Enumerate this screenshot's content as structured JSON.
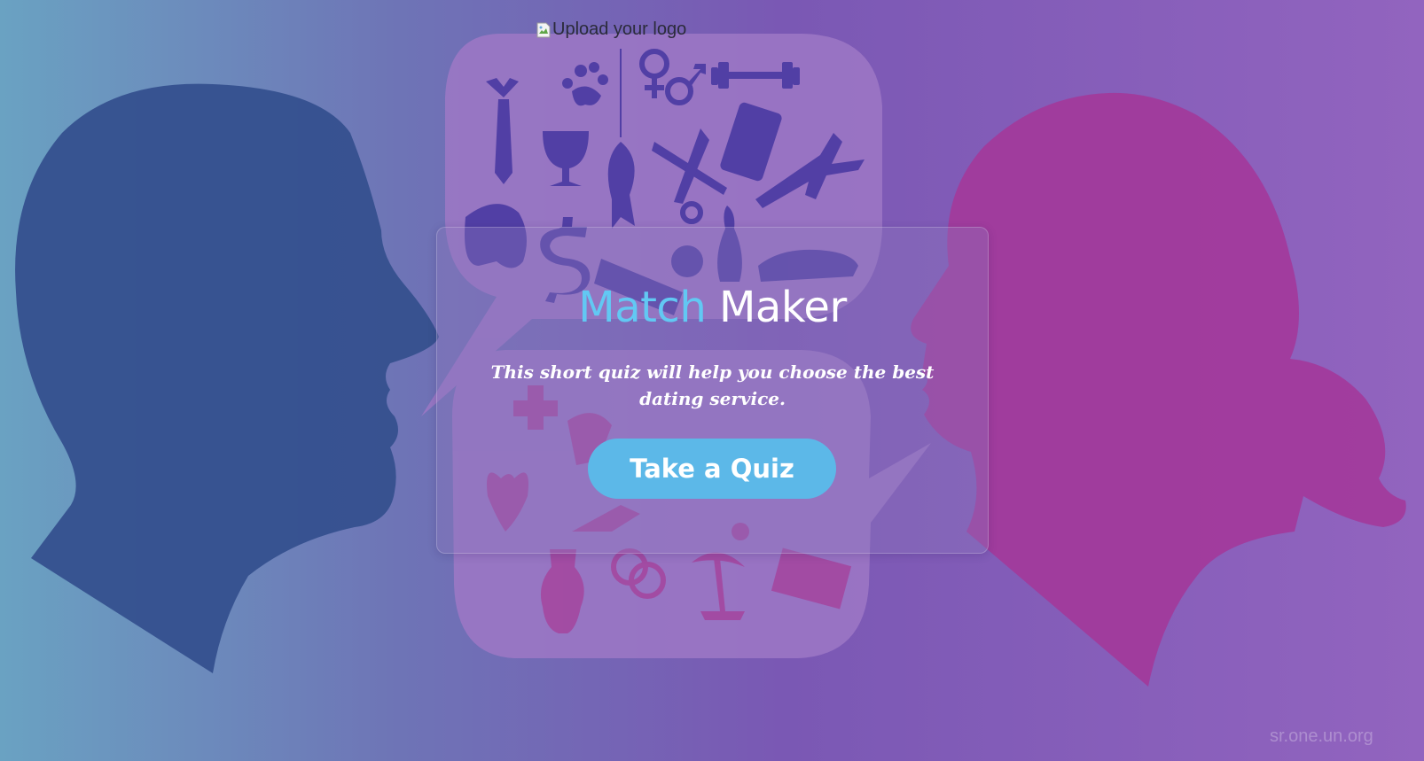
{
  "header": {
    "logo_alt": "Upload your logo",
    "logo_icon": "broken-image-icon"
  },
  "hero": {
    "title_word1": "Match",
    "title_word2": "Maker",
    "subtitle": "This short quiz will help you choose the best dating service.",
    "cta_label": "Take a Quiz"
  },
  "background": {
    "watermark": "sr.one.un.org",
    "colors": {
      "gradient_left": "#6a9cc2",
      "gradient_mid": "#7a5bb6",
      "gradient_right": "#9463bd",
      "man_silhouette": "#34508f",
      "woman_silhouette": "#a2399a",
      "bubble_fill": "#9d76c4"
    }
  },
  "theme": {
    "accent": "#62c8f3",
    "button": "#5cb8e8",
    "text_light": "#ffffff"
  }
}
